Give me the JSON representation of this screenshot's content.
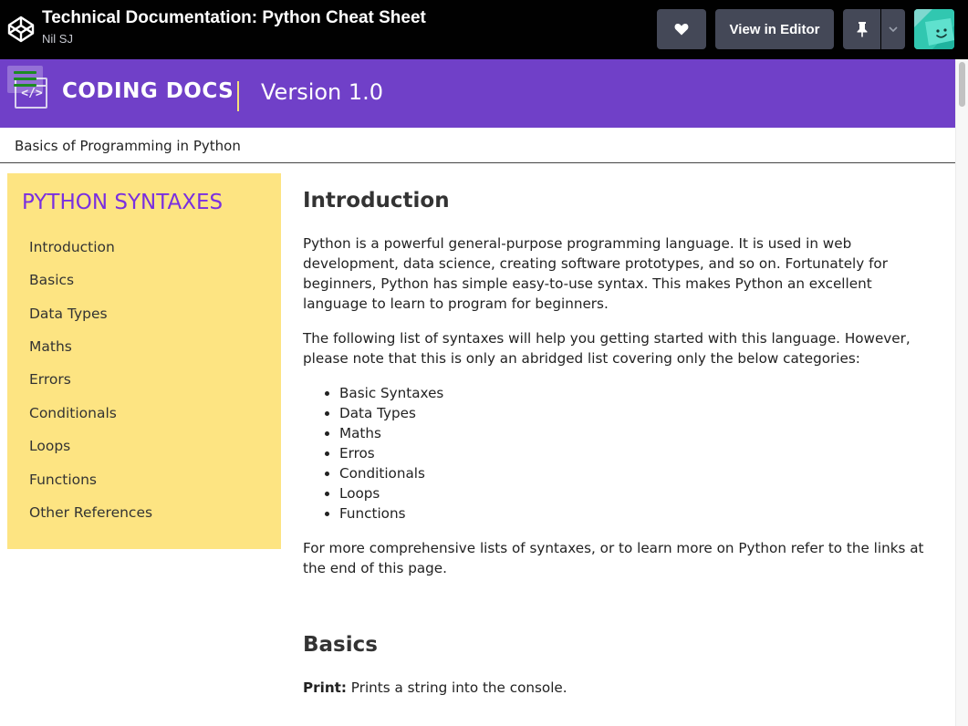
{
  "codepen": {
    "title": "Technical Documentation: Python Cheat Sheet",
    "author": "Nil SJ",
    "view_in_editor_label": "View in Editor",
    "icons": {
      "logo": "codepen-cube-icon",
      "heart": "heart-icon",
      "pin": "pin-icon",
      "dropdown": "chevron-down-icon",
      "avatar": "smiley-avatar"
    }
  },
  "header": {
    "brand": "CODING DOCS",
    "version": "Version 1.0",
    "code_icon_text": "</>",
    "colors": {
      "background": "#7040c8",
      "separator": "#f5e07a",
      "menu_icon": "#1d8b22"
    }
  },
  "subtitle": "Basics of Programming in Python",
  "sidebar": {
    "title": "PYTHON SYNTAXES",
    "items": [
      {
        "label": "Introduction"
      },
      {
        "label": "Basics"
      },
      {
        "label": "Data Types"
      },
      {
        "label": "Maths"
      },
      {
        "label": "Errors"
      },
      {
        "label": "Conditionals"
      },
      {
        "label": "Loops"
      },
      {
        "label": "Functions"
      },
      {
        "label": "Other References"
      }
    ],
    "colors": {
      "background": "#fde482",
      "title": "#7a2fe0"
    }
  },
  "main": {
    "intro": {
      "heading": "Introduction",
      "p1": "Python is a powerful general-purpose programming language. It is used in web development, data science, creating software prototypes, and so on. Fortunately for beginners, Python has simple easy-to-use syntax. This makes Python an excellent language to learn to program for beginners.",
      "p2": "The following list of syntaxes will help you getting started with this language. However, please note that this is only an abridged list covering only the below categories:",
      "list": [
        "Basic Syntaxes",
        "Data Types",
        "Maths",
        "Erros",
        "Conditionals",
        "Loops",
        "Functions"
      ],
      "p3": "For more comprehensive lists of syntaxes, or to learn more on Python refer to the links at the end of this page."
    },
    "basics": {
      "heading": "Basics",
      "print_label": "Print:",
      "print_text": " Prints a string into the console."
    }
  }
}
